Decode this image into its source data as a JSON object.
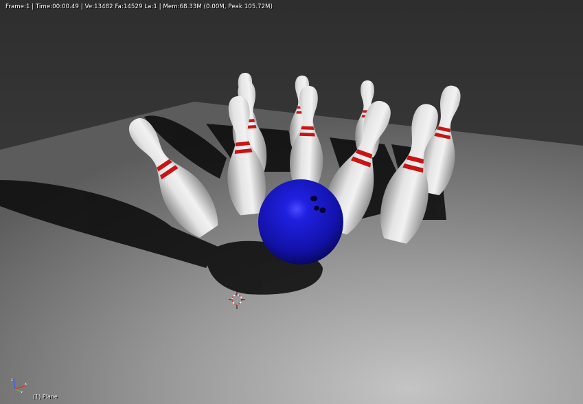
{
  "viewport": {
    "stats_text": "Frame:1 | Time:00:00.49 | Ve:13482 Fa:14529 La:1 | Mem:68.33M (0.00M, Peak 105.72M)",
    "active_object_label": "(1) Plane"
  },
  "icons": {
    "axis_gizmo": "axis-gizmo-icon",
    "cursor": "3d-cursor-icon"
  },
  "colors": {
    "pin": "#d9d9d9",
    "pin_stripe": "#c81414",
    "ball": "#1414c8",
    "axis_x": "#d23c3c",
    "axis_y": "#3cc83c",
    "axis_z": "#3c64e6"
  }
}
